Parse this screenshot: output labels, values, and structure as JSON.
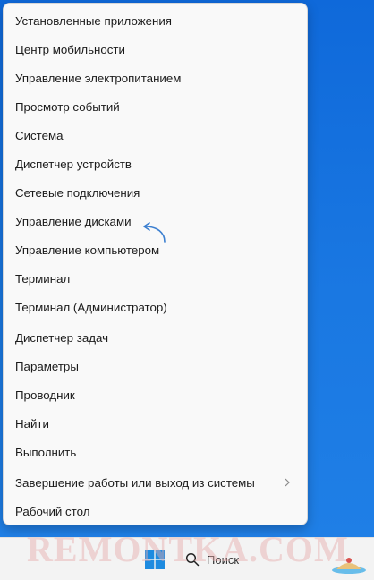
{
  "menu": {
    "items": [
      {
        "label": "Установленные приложения"
      },
      {
        "label": "Центр мобильности"
      },
      {
        "label": "Управление электропитанием"
      },
      {
        "label": "Просмотр событий"
      },
      {
        "label": "Система"
      },
      {
        "label": "Диспетчер устройств"
      },
      {
        "label": "Сетевые подключения"
      },
      {
        "label": "Управление дисками"
      },
      {
        "label": "Управление компьютером"
      },
      {
        "label": "Терминал"
      },
      {
        "label": "Терминал (Администратор)"
      },
      {
        "label": "Диспетчер задач"
      },
      {
        "label": "Параметры"
      },
      {
        "label": "Проводник"
      },
      {
        "label": "Найти"
      },
      {
        "label": "Выполнить"
      },
      {
        "label": "Завершение работы или выход из системы",
        "has_submenu": true
      },
      {
        "label": "Рабочий стол"
      }
    ]
  },
  "taskbar": {
    "start_icon": "windows-logo-icon",
    "search_icon": "search-icon",
    "search_label": "Поиск"
  },
  "annotation": {
    "arrow_target": "Управление дисками",
    "arrow_color": "#3b7fd0"
  },
  "watermark": {
    "text": "REMONTKA.COM"
  },
  "colors": {
    "desktop": "#1a73d9",
    "menu_bg": "#f9f9f9",
    "text": "#1b1b1b",
    "taskbar": "#f3f3f3",
    "windows_logo": "#1e8be0"
  }
}
